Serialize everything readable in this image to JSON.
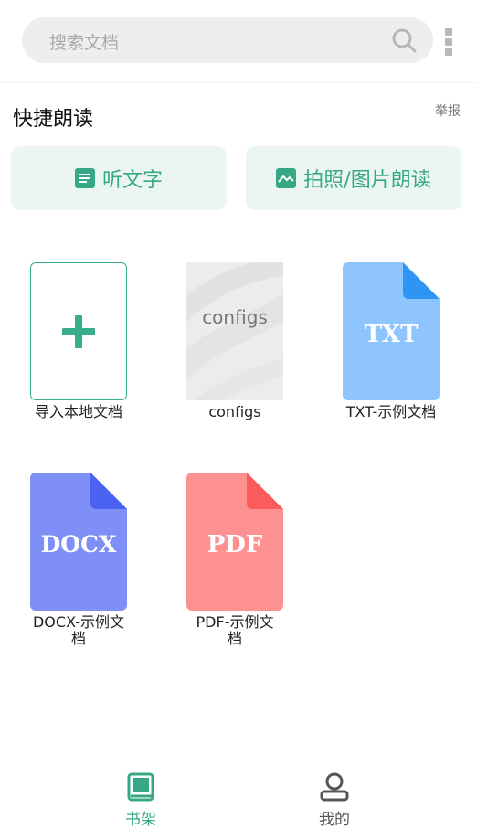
{
  "search": {
    "placeholder": "搜索文档"
  },
  "quick": {
    "title": "快捷朗读",
    "report": "举报",
    "listen_label": "听文字",
    "photo_label": "拍照/图片朗读"
  },
  "shelf": {
    "items": [
      {
        "label": "导入本地文档"
      },
      {
        "label": "configs",
        "cover_text": "configs"
      },
      {
        "label": "TXT-示例文档",
        "badge": "TXT"
      },
      {
        "label": "DOCX-示例文\n档",
        "badge": "DOCX"
      },
      {
        "label": "PDF-示例文\n档",
        "badge": "PDF"
      }
    ]
  },
  "nav": {
    "shelf_label": "书架",
    "mine_label": "我的"
  },
  "colors": {
    "accent": "#36a885",
    "txt": "#8ec5ff",
    "docx": "#7e8ff8",
    "pdf": "#fd9191"
  }
}
